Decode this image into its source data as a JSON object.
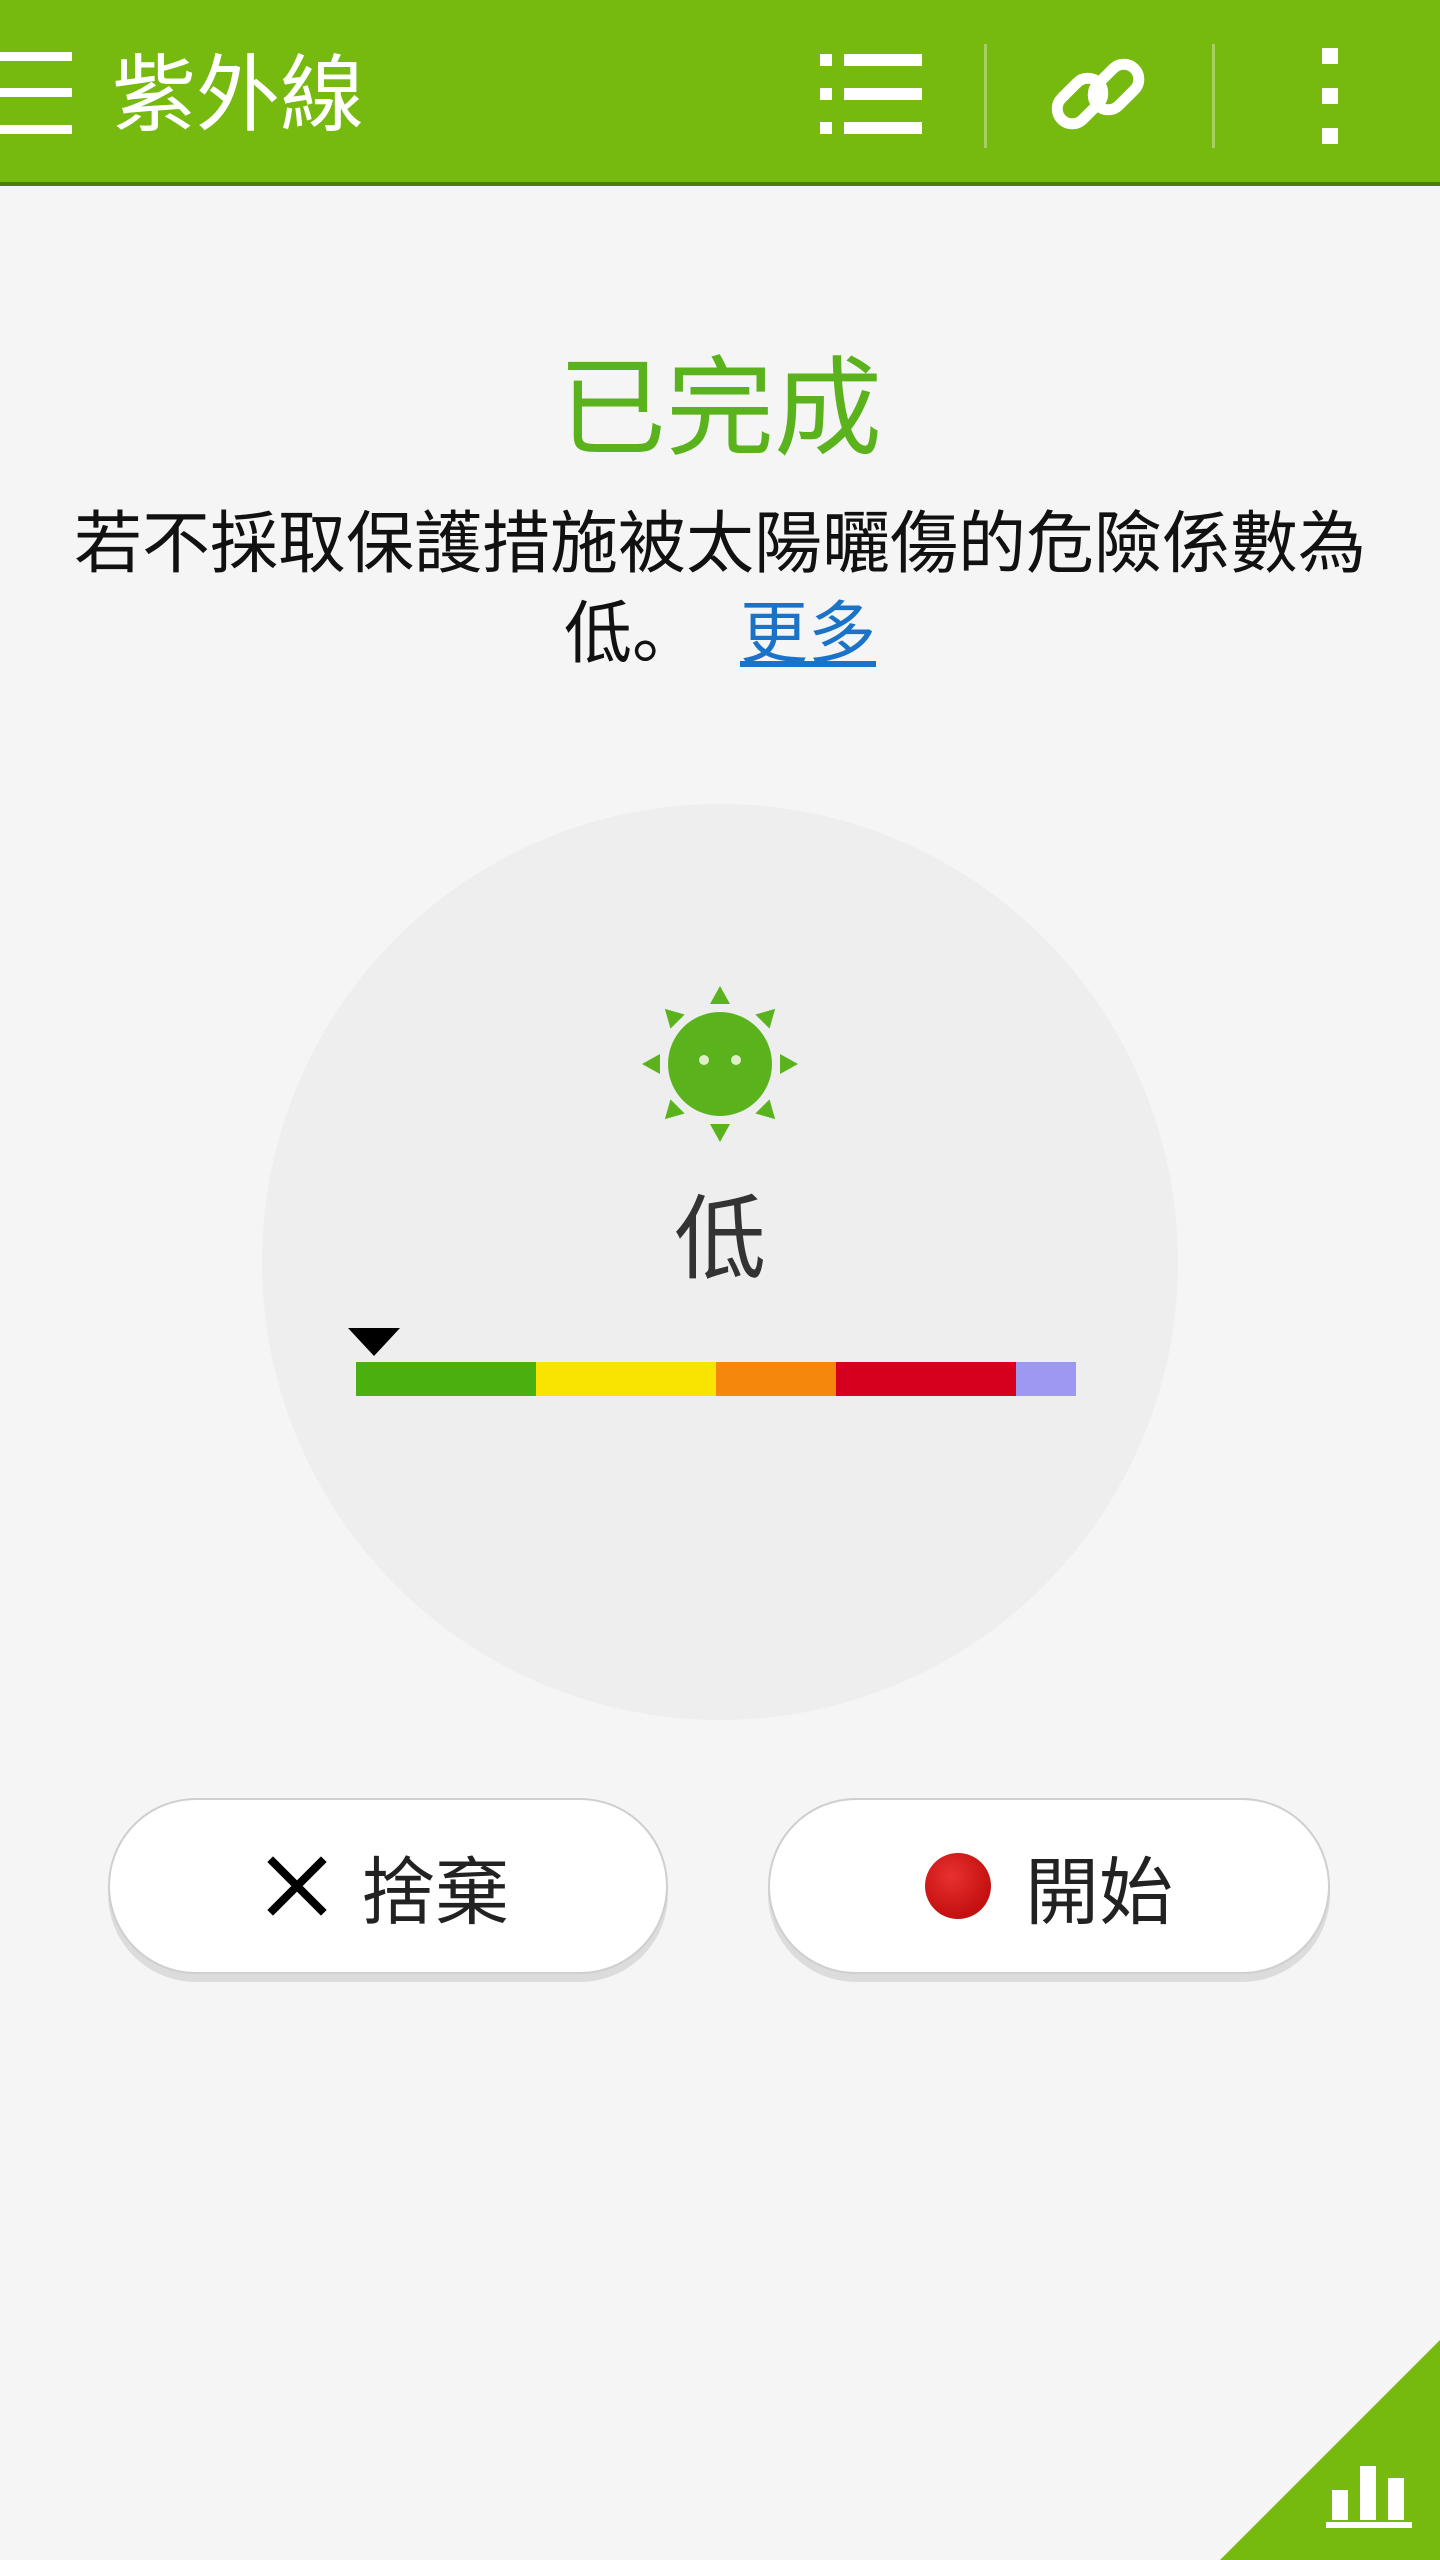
{
  "header": {
    "title": "紫外線"
  },
  "status": {
    "title": "已完成",
    "message": "若不採取保護措施被太陽曬傷的危險係數為低。",
    "more_link": "更多"
  },
  "gauge": {
    "level_label": "低",
    "level_fraction": 0.0,
    "segments": [
      {
        "color": "#4caf10",
        "weight": 3
      },
      {
        "color": "#f9e300",
        "weight": 3
      },
      {
        "color": "#f5870c",
        "weight": 2
      },
      {
        "color": "#d6001e",
        "weight": 3
      },
      {
        "color": "#9d98f2",
        "weight": 1
      }
    ]
  },
  "buttons": {
    "discard_label": "捨棄",
    "start_label": "開始"
  },
  "colors": {
    "accent": "#76b90f",
    "status_green": "#5ab31c",
    "link_blue": "#1a73c9",
    "record_red": "#cc1515"
  },
  "icons": {
    "menu": "hamburger-menu-icon",
    "list": "list-icon",
    "link": "link-icon",
    "more": "more-vert-icon",
    "sun": "sun-face-icon",
    "close": "x-icon",
    "record": "record-dot-icon",
    "chart": "bar-chart-icon"
  }
}
